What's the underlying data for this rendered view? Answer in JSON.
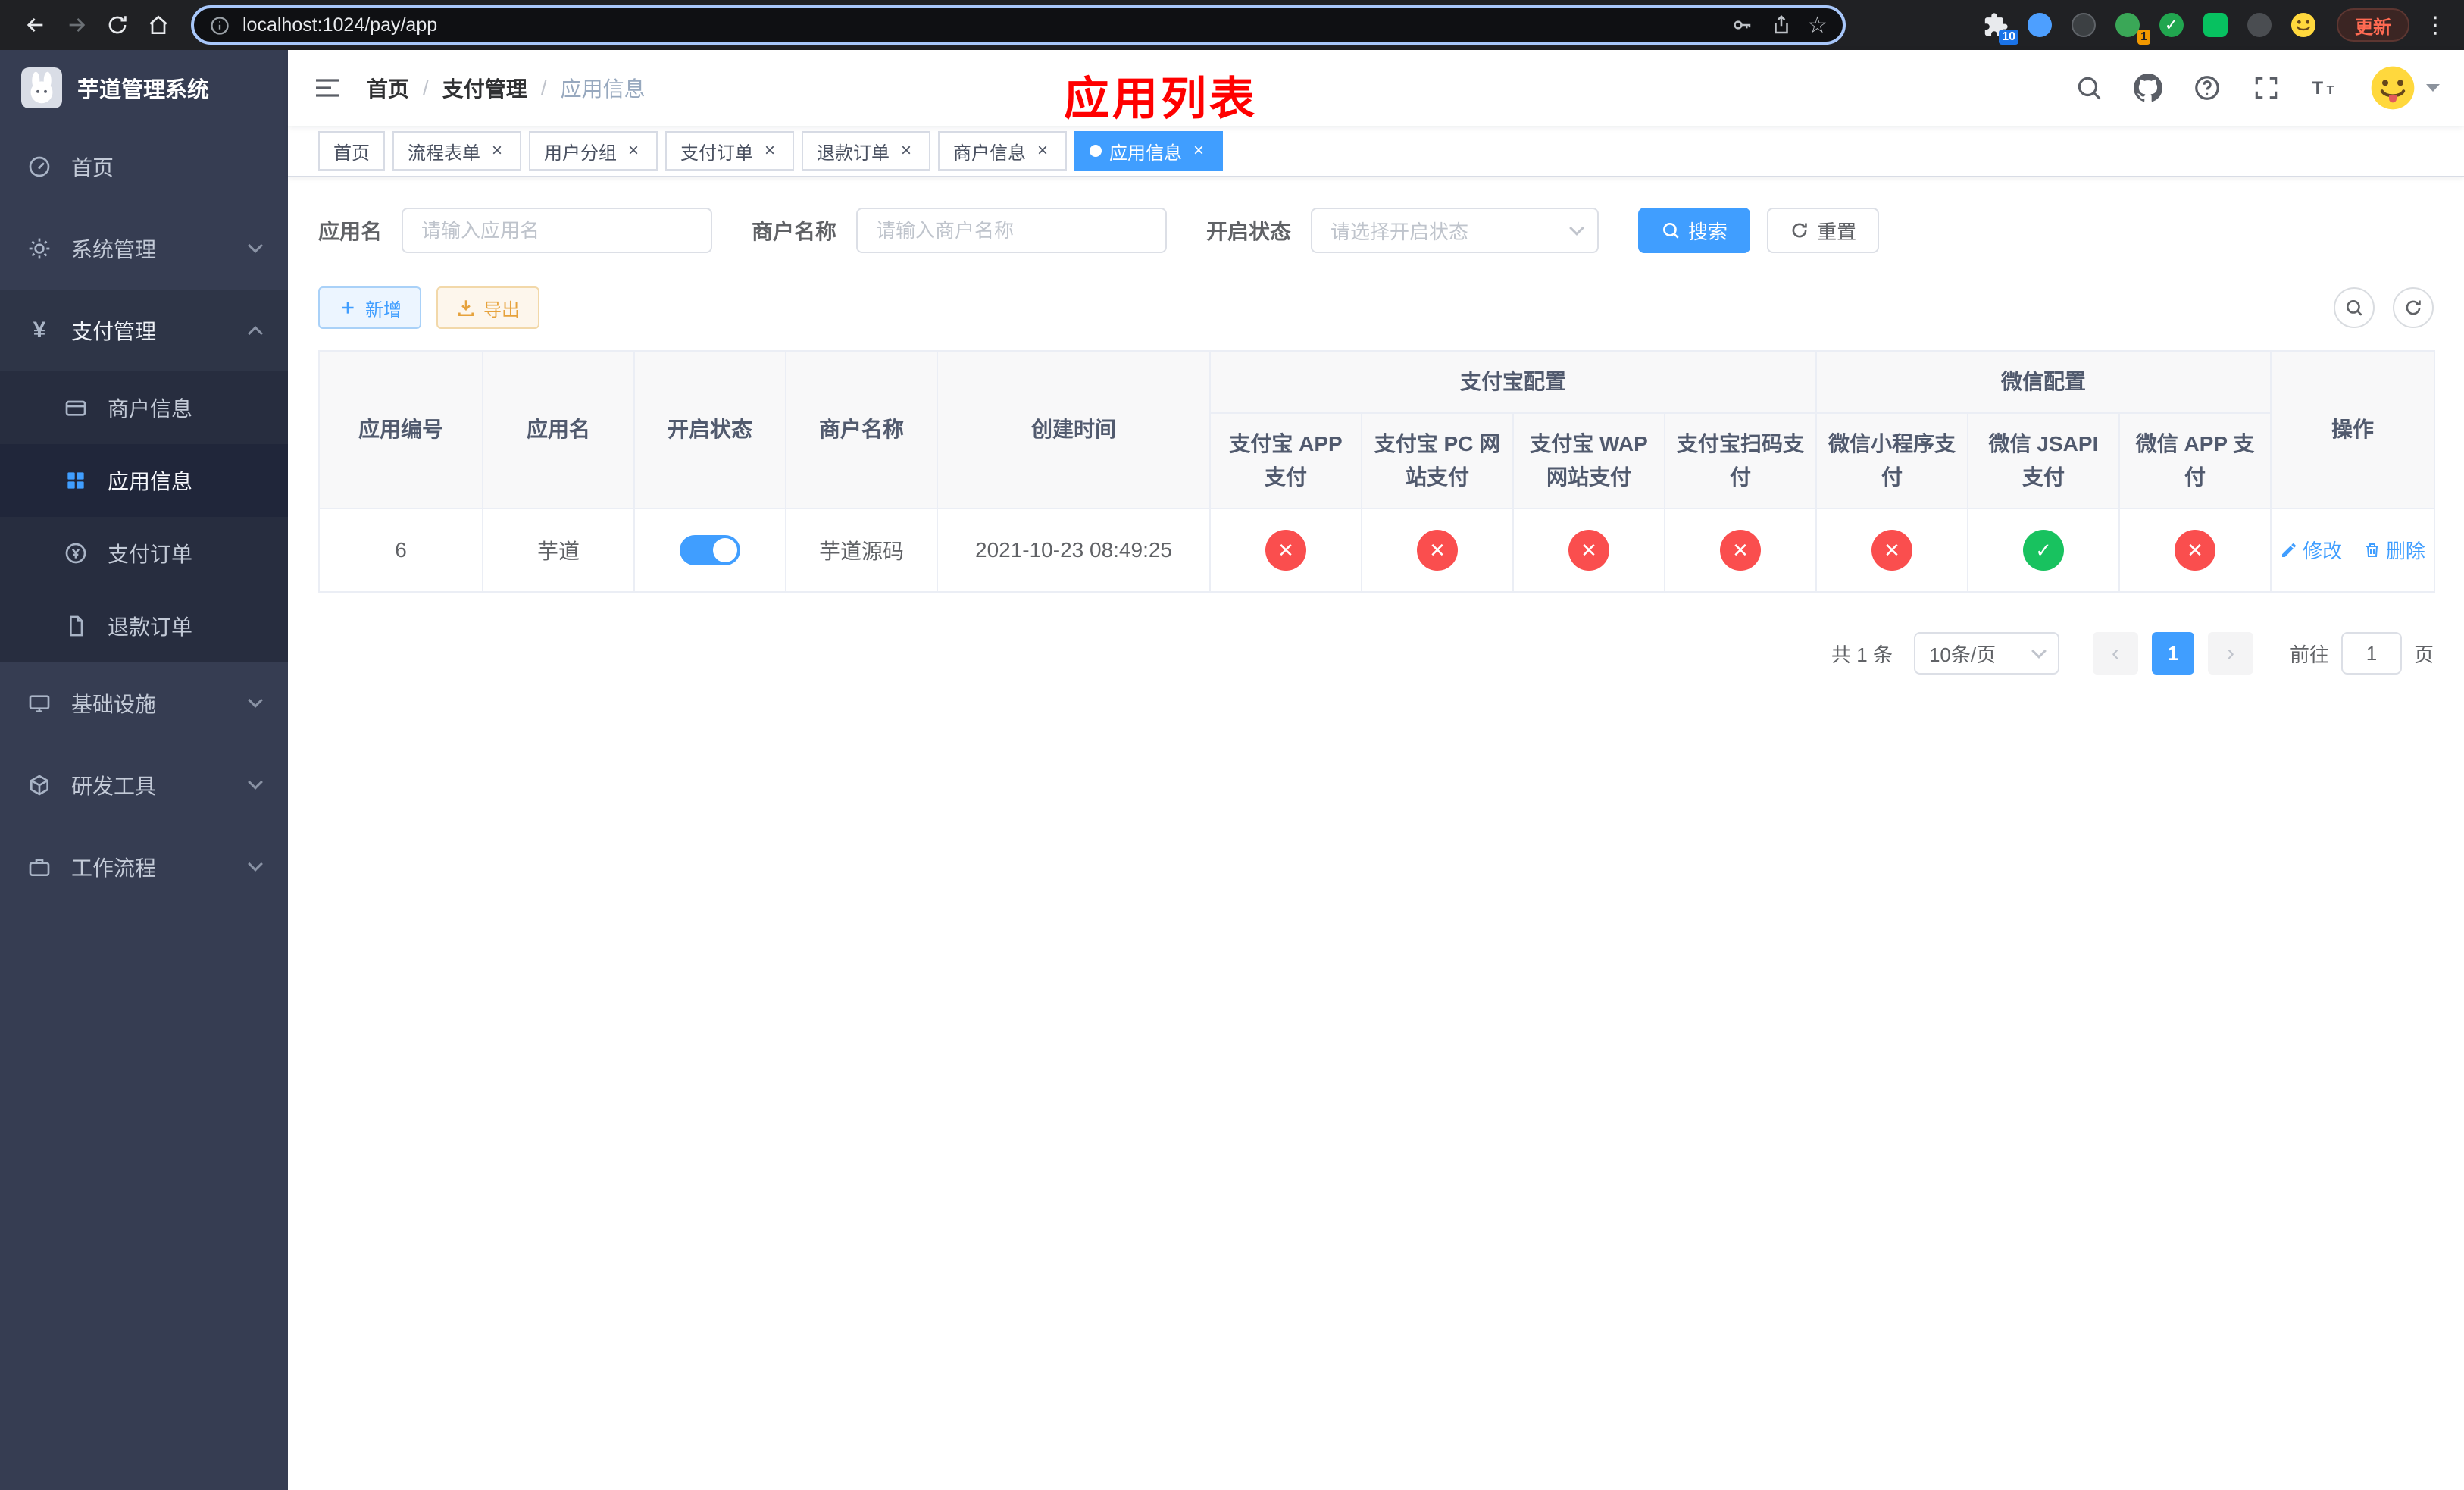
{
  "colors": {
    "accent": "#409eff",
    "danger": "#fa4e4e",
    "success": "#18c25f",
    "warning": "#e6a23c",
    "sidebar_bg": "#363d52",
    "overlay_title_color": "#ff0000"
  },
  "browser": {
    "url": "localhost:1024/pay/app",
    "update_button": "更新",
    "extensions_badge": "10",
    "avatar_badge": "1"
  },
  "sidebar": {
    "logo_title": "芋道管理系统",
    "items": [
      {
        "id": "home",
        "label": "首页"
      },
      {
        "id": "system",
        "label": "系统管理"
      },
      {
        "id": "payment",
        "label": "支付管理"
      },
      {
        "id": "merchant-info",
        "label": "商户信息"
      },
      {
        "id": "app-info",
        "label": "应用信息"
      },
      {
        "id": "pay-order",
        "label": "支付订单"
      },
      {
        "id": "refund-order",
        "label": "退款订单"
      },
      {
        "id": "infrastructure",
        "label": "基础设施"
      },
      {
        "id": "dev-tools",
        "label": "研发工具"
      },
      {
        "id": "workflow",
        "label": "工作流程"
      }
    ]
  },
  "header": {
    "breadcrumb": [
      "首页",
      "支付管理",
      "应用信息"
    ],
    "overlay_title": "应用列表"
  },
  "tabs": [
    {
      "label": "首页"
    },
    {
      "label": "流程表单"
    },
    {
      "label": "用户分组"
    },
    {
      "label": "支付订单"
    },
    {
      "label": "退款订单"
    },
    {
      "label": "商户信息"
    },
    {
      "label": "应用信息"
    }
  ],
  "filters": {
    "app_name_label": "应用名",
    "app_name_placeholder": "请输入应用名",
    "merchant_name_label": "商户名称",
    "merchant_name_placeholder": "请输入商户名称",
    "status_label": "开启状态",
    "status_placeholder": "请选择开启状态",
    "search_button": "搜索",
    "reset_button": "重置"
  },
  "toolbar": {
    "add_button": "新增",
    "export_button": "导出"
  },
  "table": {
    "headers": {
      "app_id": "应用编号",
      "app_name": "应用名",
      "open_status": "开启状态",
      "merchant_name": "商户名称",
      "create_time": "创建时间",
      "alipay_group": "支付宝配置",
      "wechat_group": "微信配置",
      "alipay_app": "支付宝 APP 支付",
      "alipay_pc": "支付宝 PC 网站支付",
      "alipay_wap": "支付宝 WAP 网站支付",
      "alipay_qr": "支付宝扫码支付",
      "wechat_mini": "微信小程序支付",
      "wechat_jsapi": "微信 JSAPI 支付",
      "wechat_app": "微信 APP 支付",
      "actions": "操作"
    },
    "rows": [
      {
        "app_id": "6",
        "app_name": "芋道",
        "open_status": "on",
        "merchant_name": "芋道源码",
        "create_time": "2021-10-23 08:49:25",
        "alipay_app": "disabled",
        "alipay_pc": "disabled",
        "alipay_wap": "disabled",
        "alipay_qr": "disabled",
        "wechat_mini": "disabled",
        "wechat_jsapi": "enabled",
        "wechat_app": "disabled",
        "edit_label": "修改",
        "delete_label": "删除"
      }
    ]
  },
  "pagination": {
    "total": "共 1 条",
    "page_size": "10条/页",
    "current_page": "1",
    "goto_label": "前往",
    "goto_value": "1",
    "goto_unit": "页"
  }
}
